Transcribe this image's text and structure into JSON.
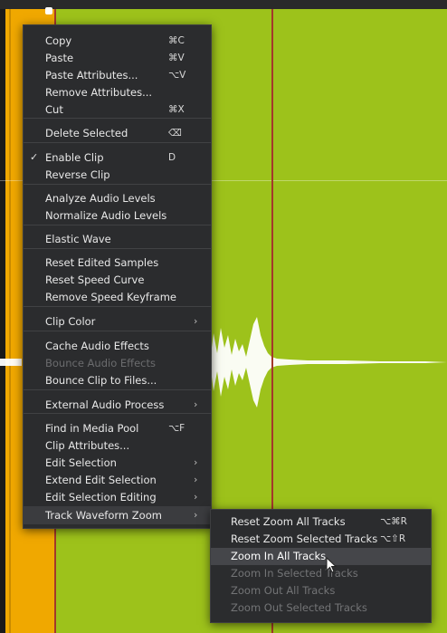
{
  "menu": {
    "items": [
      {
        "label": "Copy",
        "shortcut": "⌘C"
      },
      {
        "label": "Paste",
        "shortcut": "⌘V"
      },
      {
        "label": "Paste Attributes...",
        "shortcut": "⌥V"
      },
      {
        "label": "Remove Attributes..."
      },
      {
        "label": "Cut",
        "shortcut": "⌘X"
      },
      {
        "label": "Delete Selected",
        "shortcut": "⌫"
      },
      {
        "label": "Enable Clip",
        "shortcut": "D",
        "checked": true
      },
      {
        "label": "Reverse Clip"
      },
      {
        "label": "Analyze Audio Levels"
      },
      {
        "label": "Normalize Audio Levels"
      },
      {
        "label": "Elastic Wave"
      },
      {
        "label": "Reset Edited Samples"
      },
      {
        "label": "Reset Speed Curve"
      },
      {
        "label": "Remove Speed Keyframe"
      },
      {
        "label": "Clip Color"
      },
      {
        "label": "Cache Audio Effects"
      },
      {
        "label": "Bounce Audio Effects"
      },
      {
        "label": "Bounce Clip to Files..."
      },
      {
        "label": "External Audio Process"
      },
      {
        "label": "Find in Media Pool",
        "shortcut": "⌥F"
      },
      {
        "label": "Clip Attributes..."
      },
      {
        "label": "Edit Selection"
      },
      {
        "label": "Extend Edit Selection"
      },
      {
        "label": "Edit Selection Editing"
      },
      {
        "label": "Track Waveform Zoom"
      }
    ]
  },
  "submenu": {
    "items": [
      {
        "label": "Reset Zoom All Tracks",
        "shortcut": "⌥⌘R"
      },
      {
        "label": "Reset Zoom Selected Tracks",
        "shortcut": "⌥⇧R"
      },
      {
        "label": "Zoom In All Tracks"
      },
      {
        "label": "Zoom In Selected Tracks"
      },
      {
        "label": "Zoom Out All Tracks"
      },
      {
        "label": "Zoom Out Selected Tracks"
      }
    ]
  },
  "icons": {
    "checkmark": "✓",
    "submenu_arrow": "›"
  },
  "colors": {
    "clip_orange": "#f0a800",
    "clip_green": "#9dc21b",
    "playhead": "#a3382a",
    "menu_bg": "#2b2c2e"
  }
}
